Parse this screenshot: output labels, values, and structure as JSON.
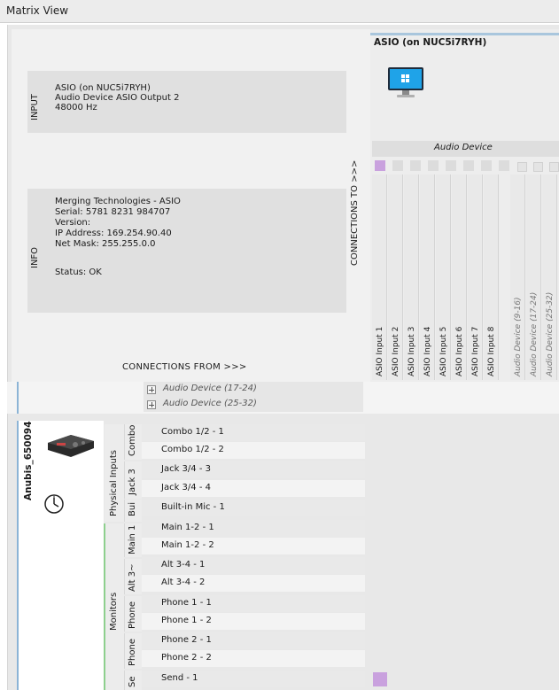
{
  "window": {
    "title": "Matrix View"
  },
  "input_section": {
    "label": "INPUT",
    "lines": [
      "ASIO (on NUC5i7RYH)",
      "Audio Device ASIO Output 2",
      "48000 Hz"
    ]
  },
  "info_section": {
    "label": "INFO",
    "lines": [
      "Merging Technologies - ASIO",
      "Serial: 5781 8231 984707",
      "Version:",
      "IP Address: 169.254.90.40",
      "Net Mask: 255.255.0.0",
      "",
      "Status: OK"
    ]
  },
  "connections_to_label": "CONNECTIONS TO >>>",
  "connections_from_label": "CONNECTIONS FROM >>>",
  "output_device": {
    "title": "ASIO (on NUC5i7RYH)",
    "icon": "monitor-windows-icon",
    "group_label": "Audio Device",
    "columns": [
      "ASIO Input 1",
      "ASIO Input 2",
      "ASIO Input 3",
      "ASIO Input 4",
      "ASIO Input 5",
      "ASIO Input 6",
      "ASIO Input 7",
      "ASIO Input 8"
    ],
    "collapsed_groups": [
      "Audio Device (9-16)",
      "Audio Device (17-24)",
      "Audio Device (25-32)"
    ]
  },
  "collapsed_input_rows": [
    "Audio Device (17-24)",
    "Audio Device (25-32)"
  ],
  "input_device": {
    "name": "Anubis_650094",
    "icons": [
      "audio-interface-icon",
      "clock-icon"
    ],
    "groups": [
      {
        "label": "Physical Inputs",
        "subgroups": [
          "Combo",
          "Jack 3",
          "Bui"
        ]
      },
      {
        "label": "Monitors",
        "subgroups": [
          "Main 1",
          "Alt 3~",
          "Phone",
          "Phone",
          "Se"
        ]
      }
    ],
    "rows": [
      "Combo 1/2 - 1",
      "Combo 1/2 - 2",
      "Jack 3/4 - 3",
      "Jack 3/4 - 4",
      "Built-in Mic - 1",
      "Main 1-2 - 1",
      "Main 1-2 - 2",
      "Alt 3-4 - 1",
      "Alt 3-4 - 2",
      "Phone 1 - 1",
      "Phone 1 - 2",
      "Phone 2 - 1",
      "Phone 2 - 2",
      "Send - 1"
    ]
  },
  "colors": {
    "active": "#c9a1de",
    "accent_blue": "#8cb4d6",
    "accent_green": "#8ed08e"
  }
}
